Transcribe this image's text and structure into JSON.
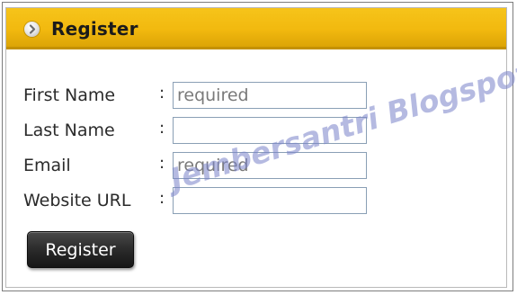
{
  "header": {
    "title": "Register",
    "icon": "chevron-right-circle-icon",
    "color": "#f2b90f"
  },
  "form": {
    "fields": [
      {
        "label": "First Name",
        "colon": ":",
        "value": "",
        "placeholder": "required"
      },
      {
        "label": "Last Name",
        "colon": ":",
        "value": "",
        "placeholder": ""
      },
      {
        "label": "Email",
        "colon": ":",
        "value": "",
        "placeholder": "required"
      },
      {
        "label": "Website URL",
        "colon": ":",
        "value": "",
        "placeholder": ""
      }
    ],
    "submit_label": "Register"
  },
  "watermark": "Jembersantri Blogspot Com"
}
